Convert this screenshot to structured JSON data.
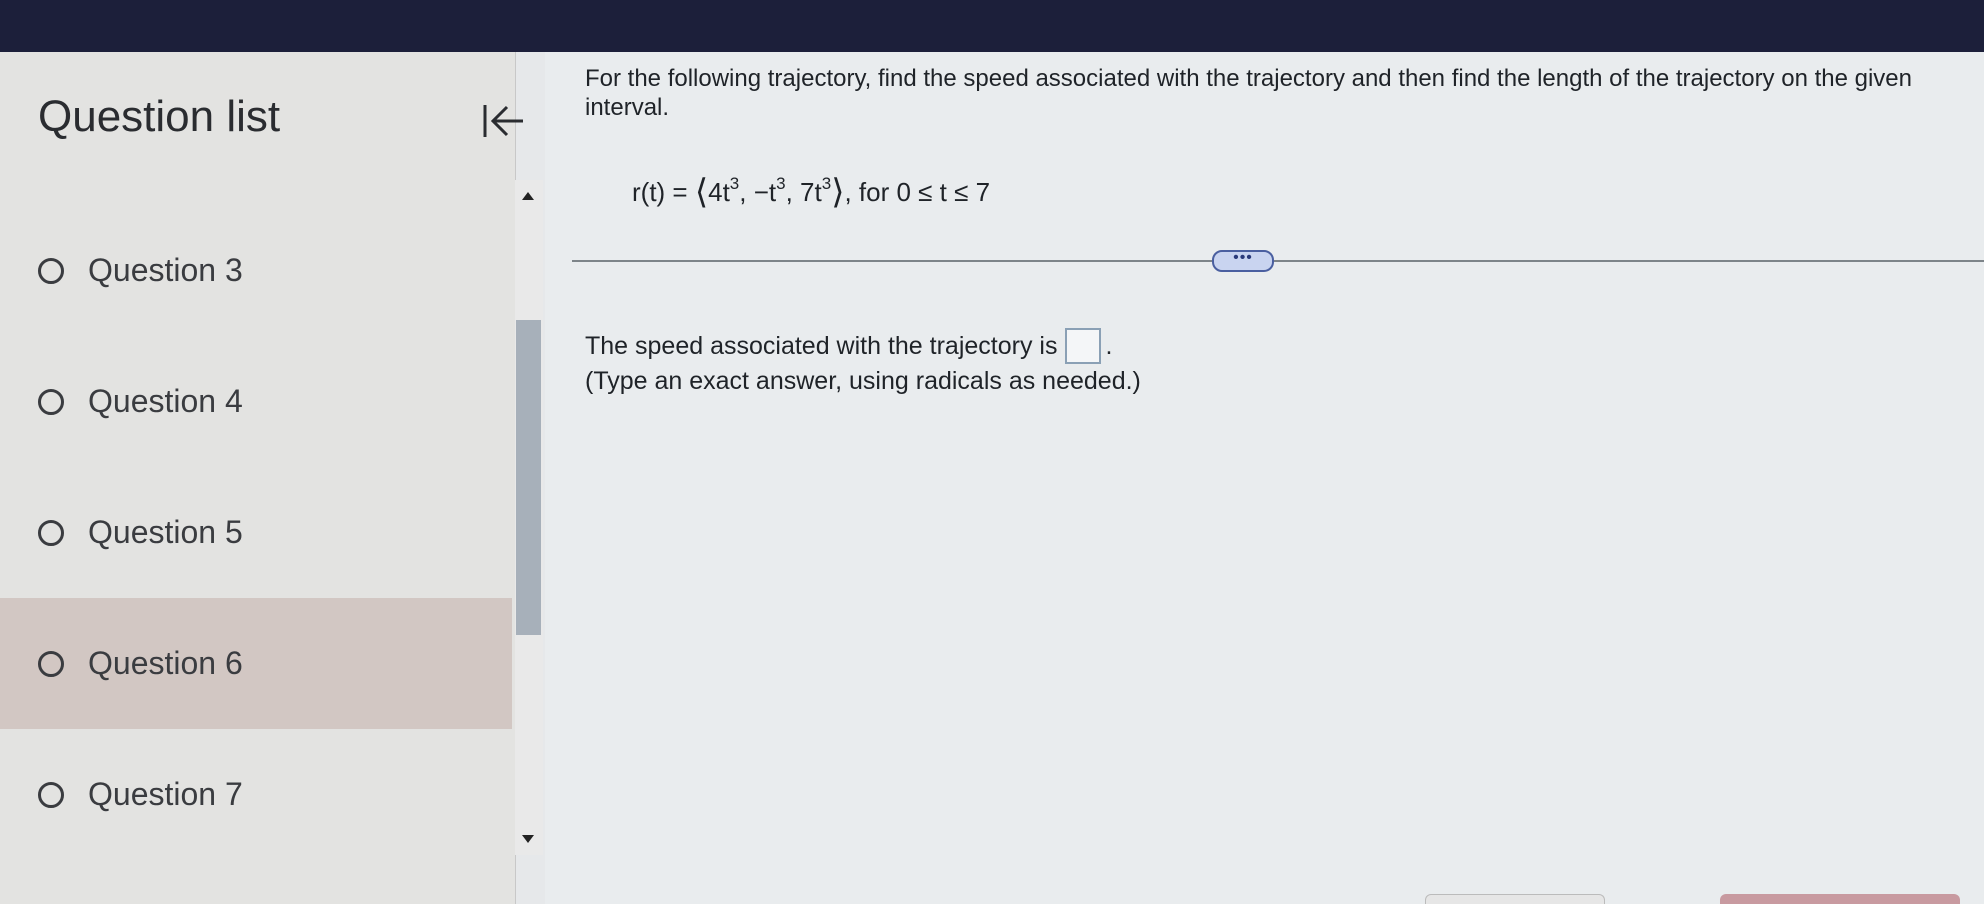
{
  "sidebar": {
    "title": "Question list",
    "questions": [
      {
        "label": "Question 3",
        "selected": false
      },
      {
        "label": "Question 4",
        "selected": false
      },
      {
        "label": "Question 5",
        "selected": false
      },
      {
        "label": "Question 6",
        "selected": true
      },
      {
        "label": "Question 7",
        "selected": false
      }
    ]
  },
  "icons": {
    "collapse": "collapse-left-icon",
    "radio": "radio-unchecked-icon",
    "scroll_up": "arrow-up-icon",
    "scroll_down": "arrow-down-icon"
  },
  "question": {
    "prompt": "For the following trajectory, find the speed associated with the trajectory and then find the length of the trajectory on the given interval.",
    "formula": {
      "lhs": "r(t) = ",
      "open": "⟨",
      "c1": "4t",
      "sep1": ", −t",
      "sep2": ", 7t",
      "close": "⟩",
      "exp": "3",
      "interval": ", for 0 ≤ t ≤ 7"
    },
    "more_label": "•••",
    "answer_text": "The speed associated with the trajectory is",
    "answer_value": "",
    "answer_end": ".",
    "hint": "(Type an exact answer, using radicals as needed.)"
  },
  "colors": {
    "topbar": "#1c1f3a",
    "selected_row": "#d2c7c3",
    "scroll_thumb": "#a7b0ba",
    "more_button": "#c9d4f0"
  }
}
